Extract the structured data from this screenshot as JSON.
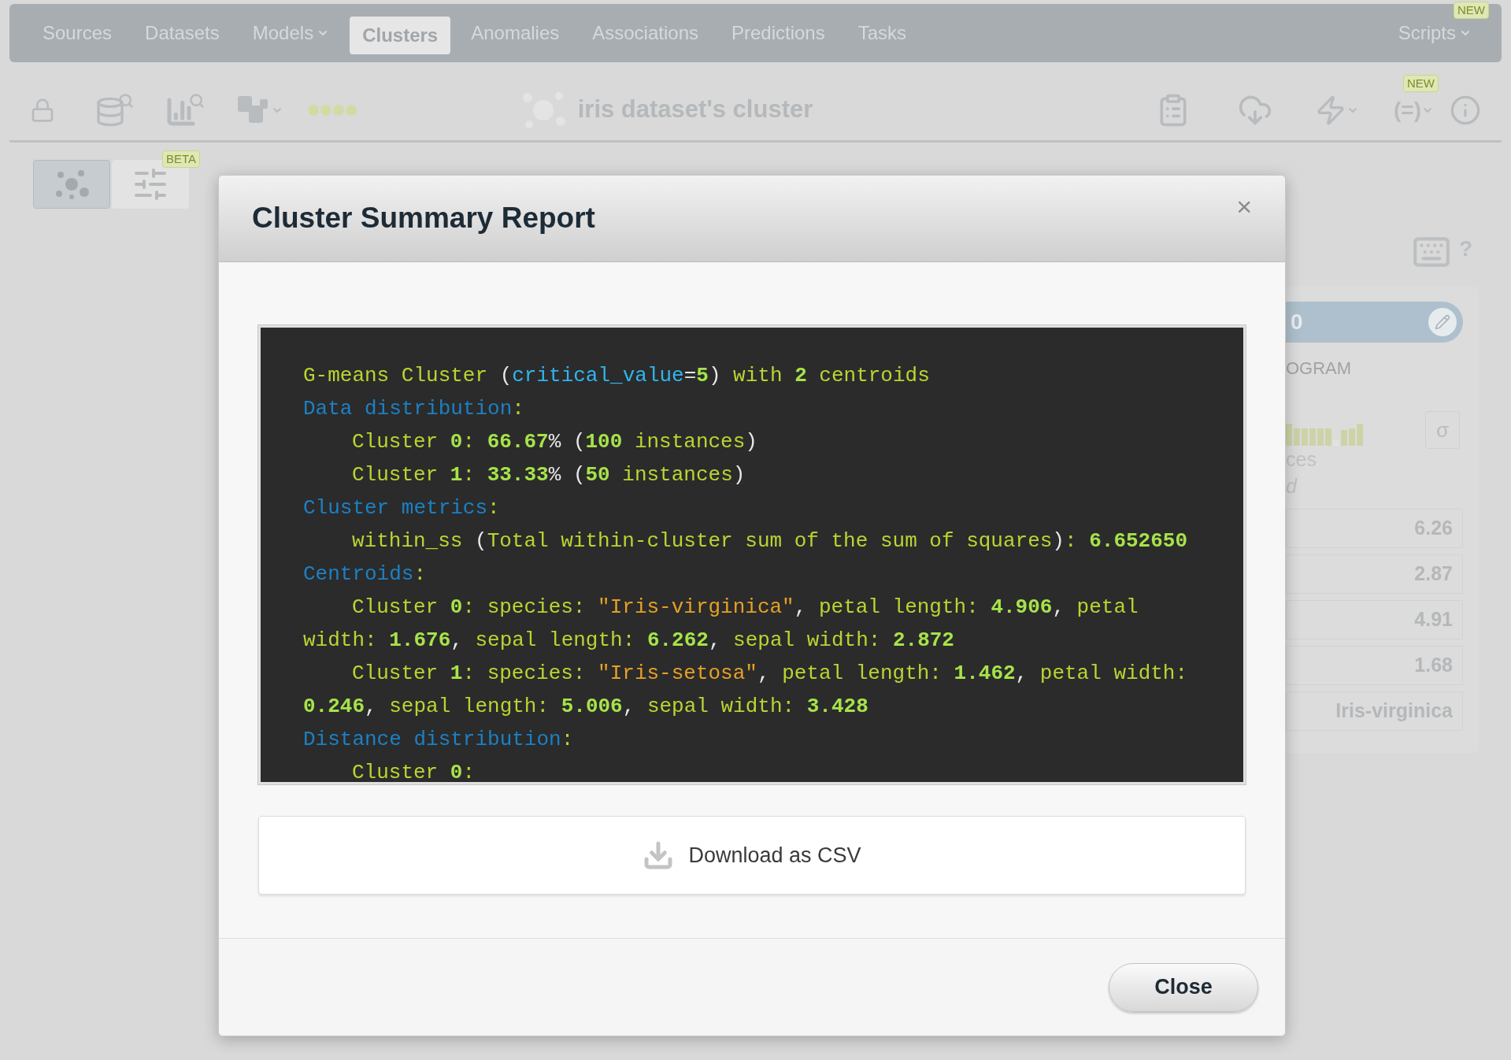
{
  "nav": {
    "items": [
      {
        "label": "Sources",
        "selected": false,
        "dropdown": false
      },
      {
        "label": "Datasets",
        "selected": false,
        "dropdown": false
      },
      {
        "label": "Models",
        "selected": false,
        "dropdown": true
      },
      {
        "label": "Clusters",
        "selected": true,
        "dropdown": false
      },
      {
        "label": "Anomalies",
        "selected": false,
        "dropdown": false
      },
      {
        "label": "Associations",
        "selected": false,
        "dropdown": false
      },
      {
        "label": "Predictions",
        "selected": false,
        "dropdown": false
      },
      {
        "label": "Tasks",
        "selected": false,
        "dropdown": false
      }
    ],
    "right": {
      "label": "Scripts",
      "badge": "NEW",
      "dropdown": true
    }
  },
  "toolbar": {
    "title": "iris dataset's cluster",
    "script_icon_text": "(=)",
    "script_badge": "NEW"
  },
  "view_tabs": [
    {
      "kind": "clusters",
      "selected": true
    },
    {
      "kind": "sliders",
      "selected": false,
      "badge": "BETA"
    }
  ],
  "side_panel": {
    "help_mark": "?",
    "pill_label": "0",
    "section_label": "OGRAM",
    "sigma": "σ",
    "instances_label": "ces",
    "note": "d",
    "values": [
      "6.26",
      "2.87",
      "4.91",
      "1.68",
      "Iris-virginica"
    ]
  },
  "dialog": {
    "title": "Cluster Summary Report",
    "close_mark": "×",
    "code_lines": [
      {
        "kind": "top",
        "tokens": [
          {
            "kind": "text",
            "text": "G-means Cluster "
          },
          {
            "kind": "op",
            "text": "("
          },
          {
            "kind": "param",
            "text": "critical_value"
          },
          {
            "kind": "op",
            "text": "="
          },
          {
            "kind": "num",
            "text": "5"
          },
          {
            "kind": "op",
            "text": ")"
          },
          {
            "kind": "text",
            "text": " with "
          },
          {
            "kind": "num",
            "text": "2"
          },
          {
            "kind": "text",
            "text": " centroids"
          }
        ]
      },
      {
        "kind": "top",
        "tokens": [
          {
            "kind": "section",
            "text": "Data distribution"
          },
          {
            "kind": "text",
            "text": ":"
          }
        ]
      },
      {
        "kind": "indented",
        "tokens": [
          {
            "kind": "text",
            "text": "Cluster "
          },
          {
            "kind": "num",
            "text": "0"
          },
          {
            "kind": "text",
            "text": ": "
          },
          {
            "kind": "num",
            "text": "66.67"
          },
          {
            "kind": "op",
            "text": "% ("
          },
          {
            "kind": "num",
            "text": "100"
          },
          {
            "kind": "text",
            "text": " instances"
          },
          {
            "kind": "op",
            "text": ")"
          }
        ]
      },
      {
        "kind": "indented",
        "tokens": [
          {
            "kind": "text",
            "text": "Cluster "
          },
          {
            "kind": "num",
            "text": "1"
          },
          {
            "kind": "text",
            "text": ": "
          },
          {
            "kind": "num",
            "text": "33.33"
          },
          {
            "kind": "op",
            "text": "% ("
          },
          {
            "kind": "num",
            "text": "50"
          },
          {
            "kind": "text",
            "text": " instances"
          },
          {
            "kind": "op",
            "text": ")"
          }
        ]
      },
      {
        "kind": "top",
        "tokens": [
          {
            "kind": "section",
            "text": "Cluster metrics"
          },
          {
            "kind": "text",
            "text": ":"
          }
        ]
      },
      {
        "kind": "indented",
        "tokens": [
          {
            "kind": "text",
            "text": "within_ss "
          },
          {
            "kind": "op",
            "text": "("
          },
          {
            "kind": "text",
            "text": "Total within-cluster sum of the sum of squares"
          },
          {
            "kind": "op",
            "text": ")"
          },
          {
            "kind": "text",
            "text": ": "
          },
          {
            "kind": "num",
            "text": "6.652650"
          }
        ]
      },
      {
        "kind": "top",
        "tokens": [
          {
            "kind": "section",
            "text": "Centroids"
          },
          {
            "kind": "text",
            "text": ":"
          }
        ]
      },
      {
        "kind": "indented",
        "tokens": [
          {
            "kind": "text",
            "text": "Cluster "
          },
          {
            "kind": "num",
            "text": "0"
          },
          {
            "kind": "text",
            "text": ": species: "
          },
          {
            "kind": "str",
            "text": "\"Iris-virginica\""
          },
          {
            "kind": "op",
            "text": ","
          },
          {
            "kind": "text",
            "text": " petal length: "
          },
          {
            "kind": "num",
            "text": "4.906"
          },
          {
            "kind": "op",
            "text": ","
          },
          {
            "kind": "text",
            "text": " petal width: "
          },
          {
            "kind": "num",
            "text": "1.676"
          },
          {
            "kind": "op",
            "text": ","
          },
          {
            "kind": "text",
            "text": " sepal length: "
          },
          {
            "kind": "num",
            "text": "6.262"
          },
          {
            "kind": "op",
            "text": ","
          },
          {
            "kind": "text",
            "text": " sepal width: "
          },
          {
            "kind": "num",
            "text": "2.872"
          }
        ]
      },
      {
        "kind": "indented",
        "tokens": [
          {
            "kind": "text",
            "text": "Cluster "
          },
          {
            "kind": "num",
            "text": "1"
          },
          {
            "kind": "text",
            "text": ": species: "
          },
          {
            "kind": "str",
            "text": "\"Iris-setosa\""
          },
          {
            "kind": "op",
            "text": ","
          },
          {
            "kind": "text",
            "text": " petal length: "
          },
          {
            "kind": "num",
            "text": "1.462"
          },
          {
            "kind": "op",
            "text": ","
          },
          {
            "kind": "text",
            "text": " petal width: "
          },
          {
            "kind": "num",
            "text": "0.246"
          },
          {
            "kind": "op",
            "text": ","
          },
          {
            "kind": "text",
            "text": " sepal length: "
          },
          {
            "kind": "num",
            "text": "5.006"
          },
          {
            "kind": "op",
            "text": ","
          },
          {
            "kind": "text",
            "text": " sepal width: "
          },
          {
            "kind": "num",
            "text": "3.428"
          }
        ]
      },
      {
        "kind": "top",
        "tokens": [
          {
            "kind": "section",
            "text": "Distance distribution"
          },
          {
            "kind": "text",
            "text": ":"
          }
        ]
      },
      {
        "kind": "indented",
        "tokens": [
          {
            "kind": "text",
            "text": "Cluster "
          },
          {
            "kind": "num",
            "text": "0"
          },
          {
            "kind": "text",
            "text": ":"
          }
        ]
      }
    ],
    "download_label": "Download as CSV",
    "close_button": "Close"
  }
}
